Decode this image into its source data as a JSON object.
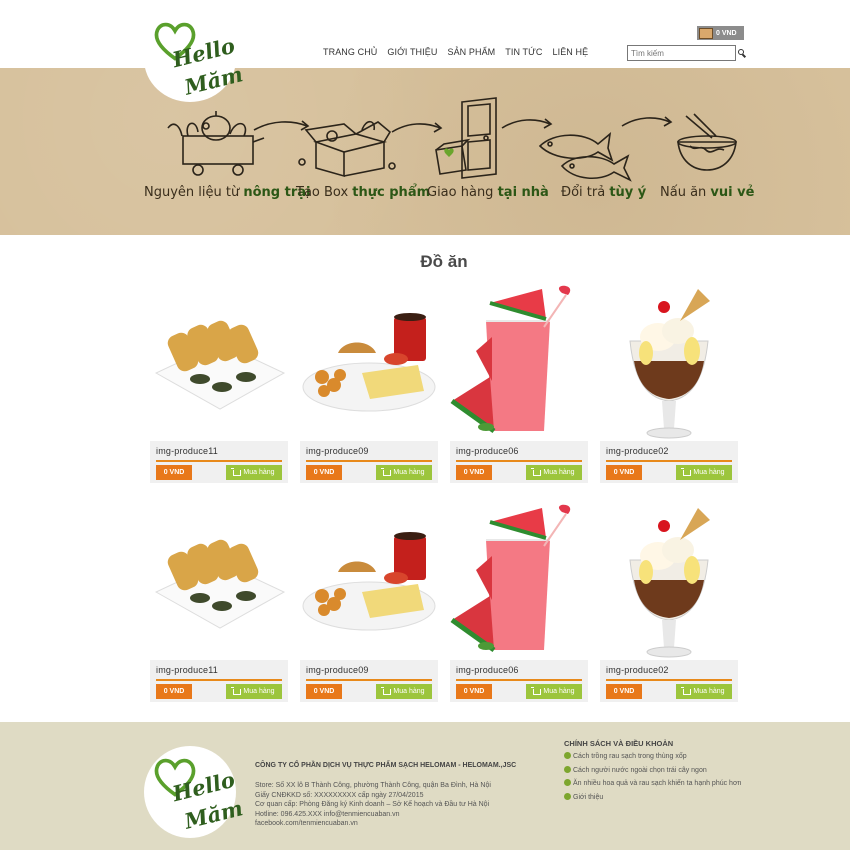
{
  "brand": {
    "line1": "Hello",
    "line2": "Măm",
    "logo_icon": "heart-logo-icon",
    "color": "#2f5e1e"
  },
  "nav": {
    "items": [
      {
        "label": "Trang chủ"
      },
      {
        "label": "Giới thiệu"
      },
      {
        "label": "Sản phẩm"
      },
      {
        "label": "Tin tức"
      },
      {
        "label": "Liên hệ"
      }
    ]
  },
  "cart": {
    "label": "0 VND",
    "icon": "cart-box-icon"
  },
  "search": {
    "placeholder": "Tìm kiếm",
    "icon": "search-icon"
  },
  "banner": {
    "steps": [
      {
        "pre": "Nguyên liệu từ ",
        "bold": "nông trại",
        "icon": "vegetable-cart-icon"
      },
      {
        "pre": "Tạo Box ",
        "bold": "thực phẩm",
        "icon": "food-box-icon"
      },
      {
        "pre": "Giao hàng ",
        "bold": "tại nhà",
        "icon": "door-delivery-icon"
      },
      {
        "pre": "Đổi trả ",
        "bold": "tùy ý",
        "icon": "fish-icon"
      },
      {
        "pre": "Nấu ăn ",
        "bold": "vui vẻ",
        "icon": "noodle-bowl-icon"
      }
    ]
  },
  "section": {
    "title": "Đồ ăn"
  },
  "products": [
    {
      "name": "img-produce11",
      "price": "0 VND",
      "buy": "Mua hàng",
      "image": "fried-rolls-plate"
    },
    {
      "name": "img-produce09",
      "price": "0 VND",
      "buy": "Mua hàng",
      "image": "breakfast-plate"
    },
    {
      "name": "img-produce06",
      "price": "0 VND",
      "buy": "Mua hàng",
      "image": "watermelon-drink"
    },
    {
      "name": "img-produce02",
      "price": "0 VND",
      "buy": "Mua hàng",
      "image": "ice-cream-sundae"
    },
    {
      "name": "img-produce11",
      "price": "0 VND",
      "buy": "Mua hàng",
      "image": "fried-rolls-plate"
    },
    {
      "name": "img-produce09",
      "price": "0 VND",
      "buy": "Mua hàng",
      "image": "breakfast-plate"
    },
    {
      "name": "img-produce06",
      "price": "0 VND",
      "buy": "Mua hàng",
      "image": "watermelon-drink"
    },
    {
      "name": "img-produce02",
      "price": "0 VND",
      "buy": "Mua hàng",
      "image": "ice-cream-sundae"
    }
  ],
  "footer": {
    "company_name": "CÔNG TY CỔ PHẦN DỊCH VỤ THỰC PHẨM SẠCH HELOMAM - HELOMAM.,JSC",
    "lines": [
      "Store: Số XX lô B Thành Công, phường Thành Công, quận Ba Đình, Hà Nội",
      "Giấy CNĐKKD số: XXXXXXXXX cấp ngày 27/04/2015",
      "Cơ quan cấp: Phòng Đăng ký Kinh doanh – Sở Kế hoạch và Đầu tư Hà Nội",
      "Hotline: 096.425.XXX info@tenmiencuaban.vn",
      "facebook.com/tenmiencuaban.vn"
    ],
    "policy_title": "CHÍNH SÁCH VÀ ĐIỀU KHOẢN",
    "policy_items": [
      "Cách trồng rau sạch trong thùng xốp",
      "Cách người nước ngoài chọn trái cây ngon",
      "Ăn nhiều hoa quả và rau sạch khiến ta hạnh phúc hơn",
      "Giới thiệu"
    ]
  },
  "colors": {
    "accent_orange": "#e8781a",
    "accent_green": "#9cc53c",
    "banner_bg": "#d6c09b",
    "footer_bg": "#dfdbc4"
  }
}
